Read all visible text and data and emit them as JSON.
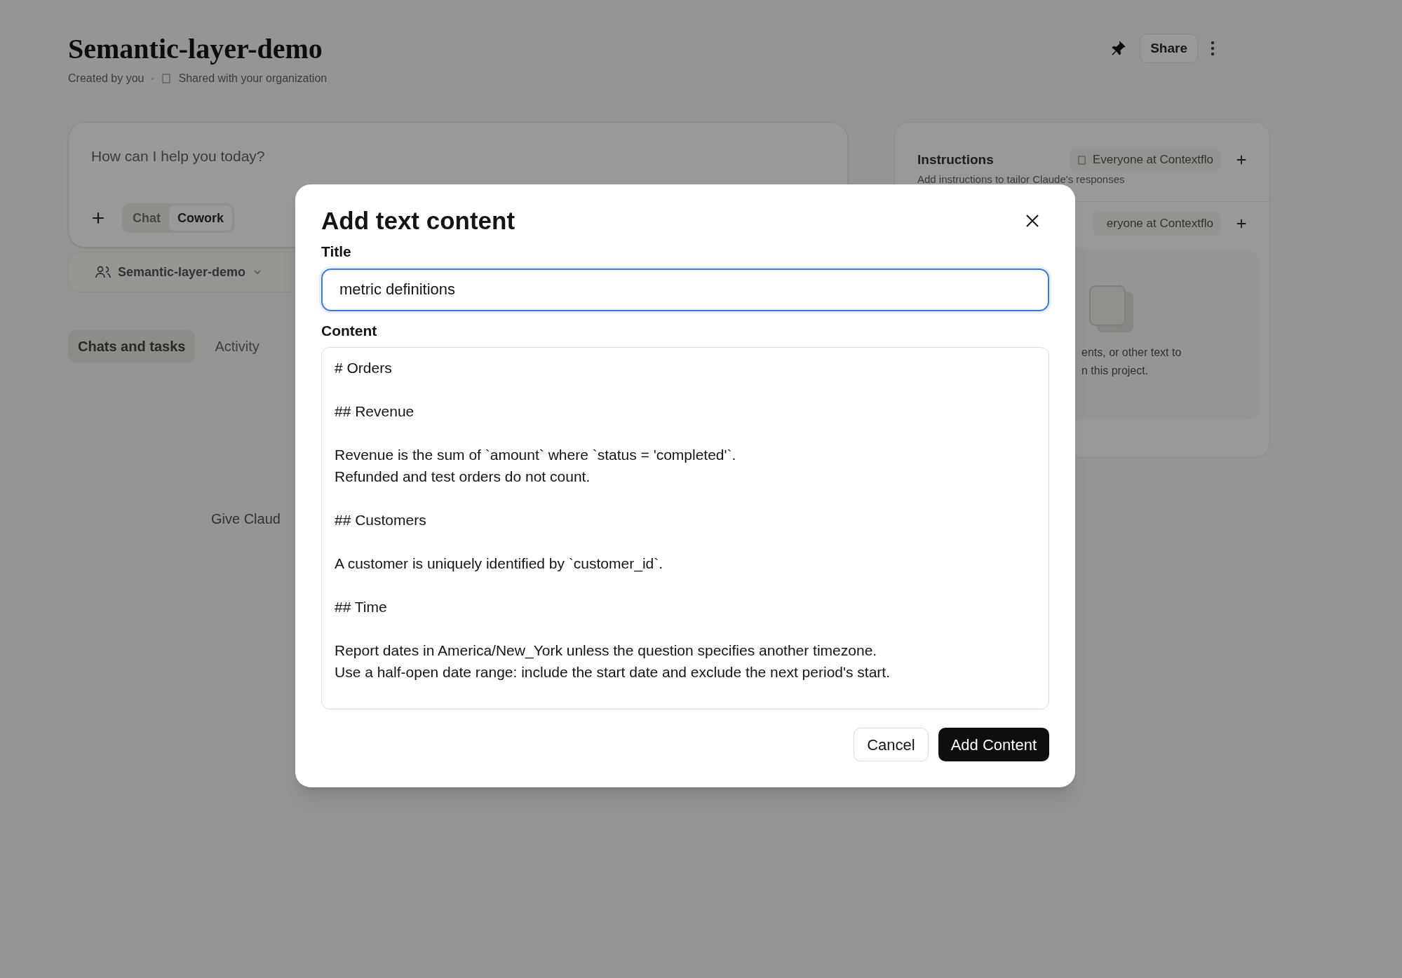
{
  "background": {
    "project_title": "Semantic-layer-demo",
    "created_by": "Created by you",
    "visibility": "Shared with your organization",
    "share_button": "Share",
    "prompt": {
      "placeholder": "How can I help you today?",
      "modes": [
        {
          "label": "Chat",
          "selected": false
        },
        {
          "label": "Cowork",
          "selected": true
        }
      ]
    },
    "project_selector": "Semantic-layer-demo",
    "tabs": [
      {
        "label": "Chats and tasks",
        "selected": true
      },
      {
        "label": "Activity",
        "selected": false
      }
    ],
    "empty_hint": "Give Claud",
    "instructions": {
      "title": "Instructions",
      "access": "Everyone at Contextflo",
      "subtitle": "Add instructions to tailor Claude's responses"
    },
    "files": {
      "access": "eryone at Contextflo",
      "hint_lines": [
        "ents, or other text to",
        "n this project."
      ]
    }
  },
  "dialog": {
    "title": "Add text content",
    "title_label": "Title",
    "title_value": "metric definitions",
    "content_label": "Content",
    "content_value": "# Orders\n\n## Revenue\n\nRevenue is the sum of `amount` where `status = 'completed'`.\nRefunded and test orders do not count.\n\n## Customers\n\nA customer is uniquely identified by `customer_id`.\n\n## Time\n\nReport dates in America/New_York unless the question specifies another timezone.\nUse a half-open date range: include the start date and exclude the next period's start.",
    "buttons": [
      {
        "kind": "secondary",
        "label": "Cancel"
      },
      {
        "kind": "primary",
        "label": "Add Content"
      }
    ]
  }
}
